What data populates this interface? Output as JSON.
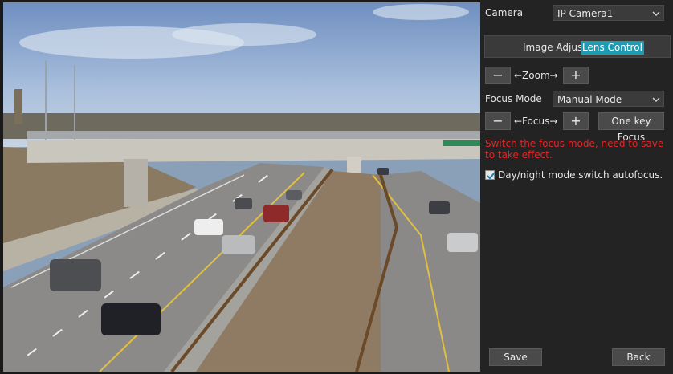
{
  "camera": {
    "label": "Camera",
    "value": "IP Camera1"
  },
  "tabs": [
    {
      "label": "Image Adjust",
      "active": false
    },
    {
      "label": "Lens Control",
      "active": true
    }
  ],
  "zoom": {
    "minus": "−",
    "label": "←Zoom→",
    "plus": "+"
  },
  "focus_mode": {
    "label": "Focus Mode",
    "value": "Manual Mode"
  },
  "focus": {
    "minus": "−",
    "label": "←Focus→",
    "plus": "+",
    "one_key": "One key Focus"
  },
  "warning": "Switch the focus mode, need to save to take effect.",
  "autofocus": {
    "label": "Day/night mode switch autofocus.",
    "checked": true
  },
  "footer": {
    "save": "Save",
    "back": "Back"
  },
  "colors": {
    "accent": "#1c9bb3",
    "warning": "#e02626",
    "panel": "#232323"
  }
}
